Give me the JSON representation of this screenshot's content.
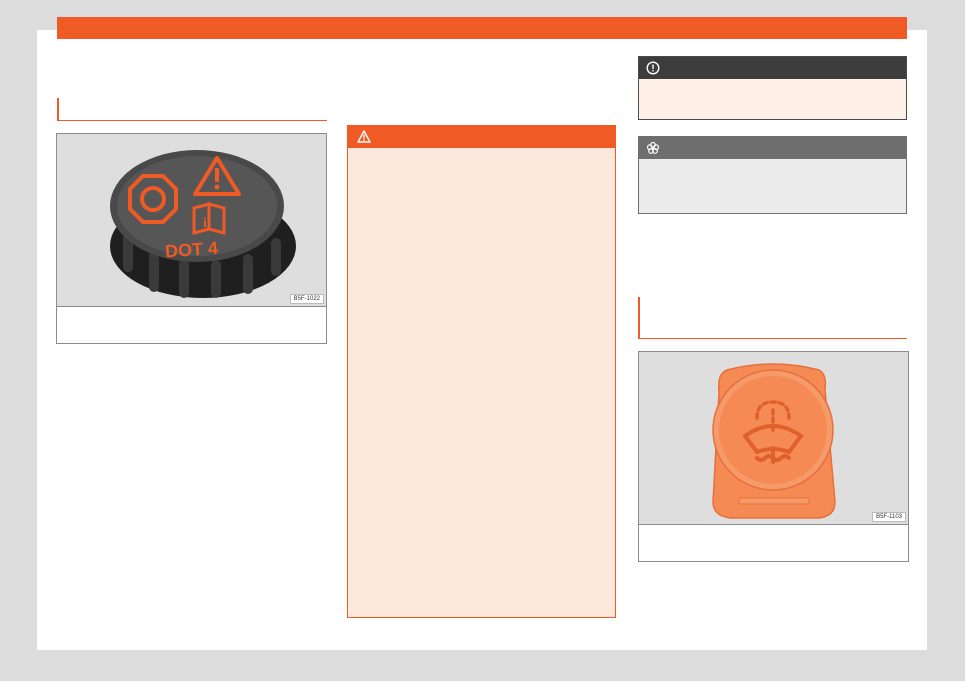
{
  "figures": {
    "brake_fluid_cap": {
      "code": "B5F-1022",
      "cap_label": "DOT 4"
    },
    "washer_fluid_cap": {
      "code": "B5F-1103"
    }
  },
  "icons": {
    "warning": "warning-triangle-icon",
    "caution": "exclamation-circle-icon",
    "environment": "flower-icon"
  },
  "colors": {
    "accent": "#f05a24",
    "warning_bg": "#fde8dc",
    "caution_bg": "#fff1e8",
    "env_head": "#6e6e6e",
    "env_bg": "#ececec"
  }
}
